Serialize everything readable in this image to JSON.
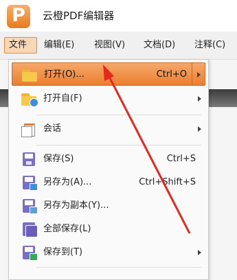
{
  "app": {
    "title": "云橙PDF编辑器",
    "logo_letter": "P"
  },
  "menubar": {
    "file": "文件",
    "edit": "编辑(E)",
    "view": "视图(V)",
    "document": "文档(D)",
    "annotate": "注释(C)"
  },
  "menu": {
    "open": {
      "label": "打开(O)...",
      "shortcut": "Ctrl+O"
    },
    "open_from": {
      "label": "打开自(F)"
    },
    "session": {
      "label": "会话"
    },
    "save": {
      "label": "保存(S)",
      "shortcut": "Ctrl+S"
    },
    "save_as": {
      "label": "另存为(A)...",
      "shortcut": "Ctrl+Shift+S"
    },
    "save_copy": {
      "label": "另存为副本(Y)..."
    },
    "save_all": {
      "label": "全部保存(L)"
    },
    "save_to": {
      "label": "保存到(T)"
    }
  },
  "colors": {
    "accent": "#ea7e2f",
    "annotation_arrow": "#e8261c"
  },
  "icons": {
    "open": "folder-icon",
    "open_from": "folder-globe-icon",
    "session": "session-icon",
    "save": "save-disk-icon",
    "save_as": "save-as-icon",
    "save_copy": "save-copy-icon",
    "save_all": "save-all-icon",
    "save_to": "save-to-icon"
  }
}
